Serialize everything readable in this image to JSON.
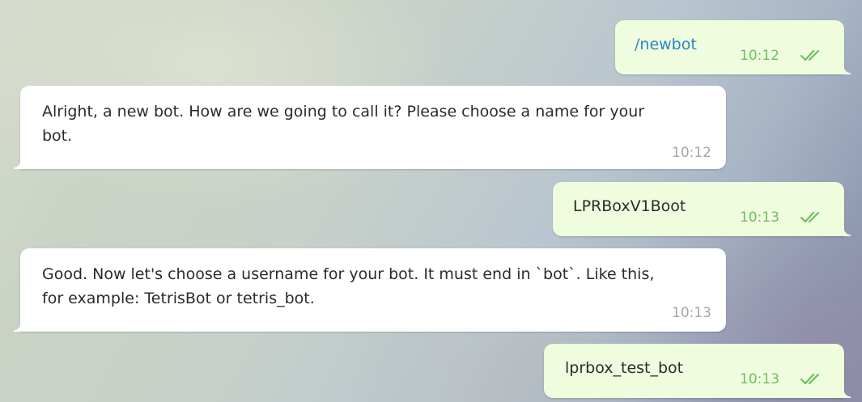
{
  "colors": {
    "outgoing_bubble": "#effdde",
    "incoming_bubble": "#ffffff",
    "command_text": "#2a86c7",
    "outgoing_time": "#6cbf62",
    "incoming_time": "#a0a6ab"
  },
  "messages": [
    {
      "direction": "outgoing",
      "text": "/newbot",
      "is_command": true,
      "time": "10:12",
      "status_icon": "double-check-icon"
    },
    {
      "direction": "incoming",
      "text": "Alright, a new bot. How are we going to call it? Please choose a name for your bot.",
      "time": "10:12"
    },
    {
      "direction": "outgoing",
      "text": "LPRBoxV1Boot",
      "time": "10:13",
      "status_icon": "double-check-icon"
    },
    {
      "direction": "incoming",
      "text": "Good. Now let's choose a username for your bot. It must end in `bot`. Like this, for example: TetrisBot or tetris_bot.",
      "time": "10:13"
    },
    {
      "direction": "outgoing",
      "text": "lprbox_test_bot",
      "time": "10:13",
      "status_icon": "double-check-icon"
    }
  ]
}
